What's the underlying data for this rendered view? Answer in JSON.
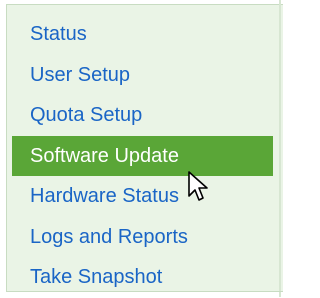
{
  "sidebar": {
    "items": [
      {
        "label": "Status",
        "active": false
      },
      {
        "label": "User Setup",
        "active": false
      },
      {
        "label": "Quota Setup",
        "active": false
      },
      {
        "label": "Software Update",
        "active": true
      },
      {
        "label": "Hardware Status",
        "active": false
      },
      {
        "label": "Logs and Reports",
        "active": false
      },
      {
        "label": "Take Snapshot",
        "active": false
      }
    ]
  },
  "colors": {
    "panel_bg": "#eaf4e6",
    "link": "#1a65c6",
    "active_bg": "#5aa637",
    "active_text": "#ffffff"
  },
  "cursor": {
    "icon": "pointer-arrow-icon"
  }
}
